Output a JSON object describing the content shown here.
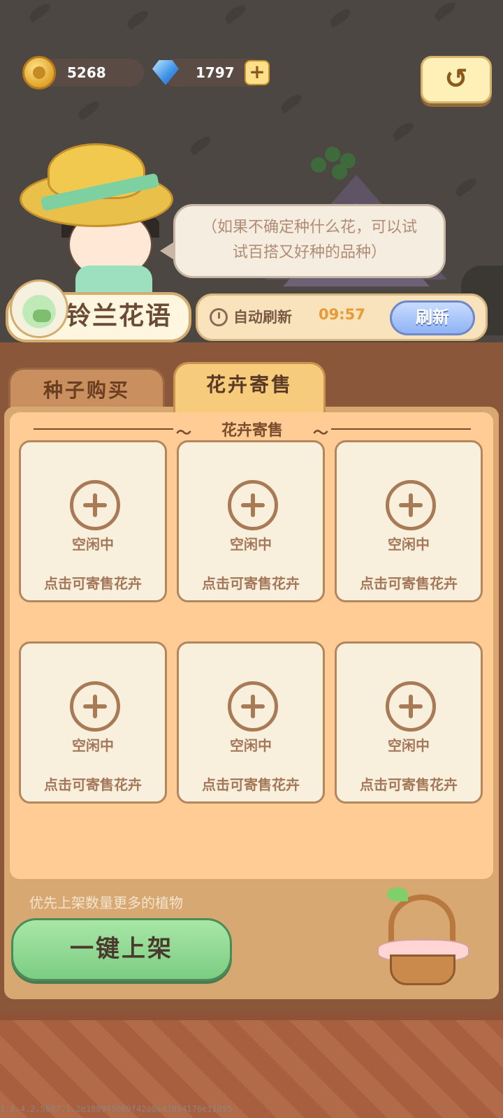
{
  "currency": {
    "coins": "5268",
    "gems": "1797",
    "add_symbol": "+"
  },
  "header": {
    "back_symbol": "↺"
  },
  "npc": {
    "speech_line1": "（如果不确定种什么花，可以试",
    "speech_line2": "试百搭又好种的品种）"
  },
  "shop": {
    "title": "铃兰花语",
    "auto_refresh_label": "自动刷新",
    "timer": "09:57",
    "refresh_label": "刷新"
  },
  "tabs": [
    {
      "label": "种子购买",
      "active": false
    },
    {
      "label": "花卉寄售",
      "active": true
    }
  ],
  "section": {
    "title": "花卉寄售"
  },
  "slots": [
    {
      "status": "空闲中",
      "hint": "点击可寄售花卉"
    },
    {
      "status": "空闲中",
      "hint": "点击可寄售花卉"
    },
    {
      "status": "空闲中",
      "hint": "点击可寄售花卉"
    },
    {
      "status": "空闲中",
      "hint": "点击可寄售花卉"
    },
    {
      "status": "空闲中",
      "hint": "点击可寄售花卉"
    },
    {
      "status": "空闲中",
      "hint": "点击可寄售花卉"
    }
  ],
  "footer": {
    "tip": "优先上架数量更多的植物",
    "one_key_label": "一键上架"
  },
  "version": "1.0.4.2.5687.1.2e180945809f42a8e43094176e11855"
}
